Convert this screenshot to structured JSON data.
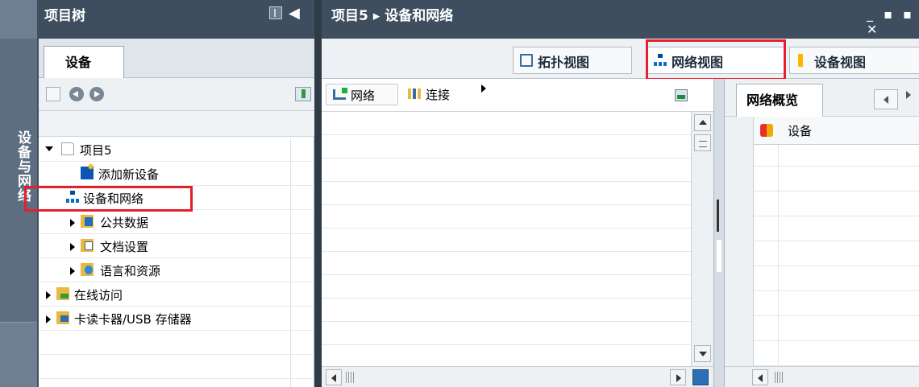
{
  "project_tree": {
    "title": "项目树",
    "side_label": "设备与网络",
    "tab": "设备",
    "items": [
      {
        "label": "项目5",
        "expanded": true,
        "icon": "project-page-icon"
      },
      {
        "label": "添加新设备",
        "icon": "add-device-icon"
      },
      {
        "label": "设备和网络",
        "icon": "network-icon",
        "highlighted": true
      },
      {
        "label": "公共数据",
        "icon": "folder-icon"
      },
      {
        "label": "文档设置",
        "icon": "folder-icon"
      },
      {
        "label": "语言和资源",
        "icon": "folder-icon"
      },
      {
        "label": "在线访问",
        "icon": "folder-icon"
      },
      {
        "label": "卡读卡器/USB 存储器",
        "icon": "folder-icon"
      }
    ]
  },
  "main": {
    "breadcrumb": "项目5 ▸ 设备和网络",
    "window_controls": "_ ▪ ▪ ✕",
    "view_tabs": [
      {
        "label": "拓扑视图"
      },
      {
        "label": "网络视图",
        "active": true,
        "highlighted": true
      },
      {
        "label": "设备视图"
      }
    ],
    "toolbar": {
      "network": "网络",
      "connection": "连接"
    }
  },
  "overview": {
    "tab": "网络概览",
    "column": "设备"
  },
  "colors": {
    "title_bar": "#3e4e5e",
    "highlight": "#e3202c",
    "side_strip": "#5c6e80"
  }
}
